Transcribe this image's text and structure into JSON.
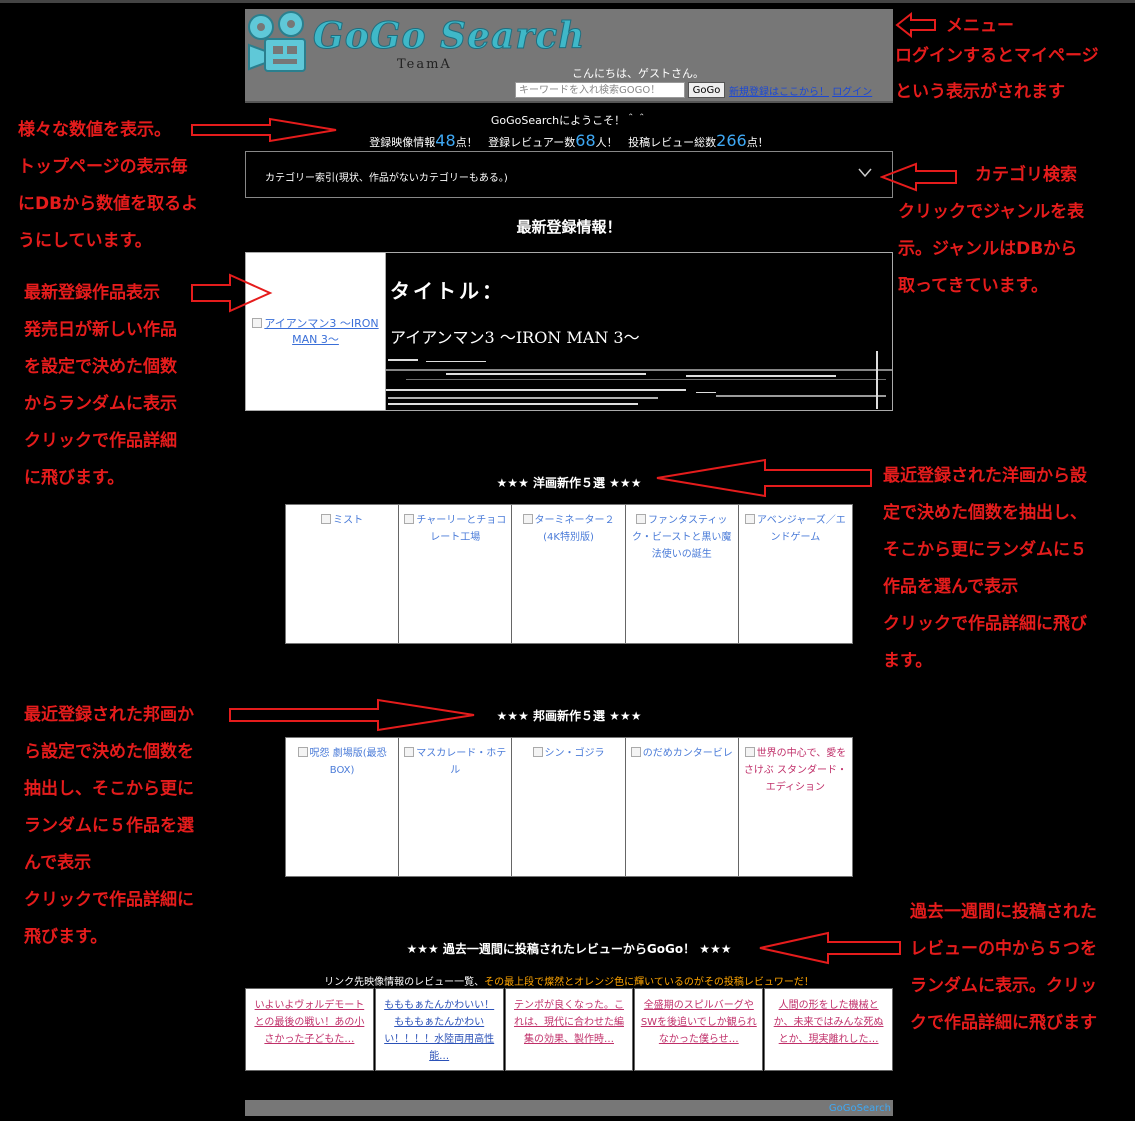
{
  "header": {
    "logo_text": "GoGo Search",
    "team": "TeamA",
    "greeting": "こんにちは、ゲストさん。",
    "search_placeholder": "キーワードを入れ検索GOGO！",
    "search_button": "GoGo",
    "register_link": "新規登録はここから！",
    "login_link": "ログイン"
  },
  "welcome": "GoGoSearchにようこそ！＾＾",
  "stats": {
    "movies_label": "登録映像情報",
    "movies_count": "48",
    "movies_unit": "点！",
    "reviewers_label": "登録レビュアー数",
    "reviewers_count": "68",
    "reviewers_unit": "人！",
    "reviews_label": "投稿レビュー総数",
    "reviews_count": "266",
    "reviews_unit": "点！"
  },
  "category": {
    "label": "カテゴリー索引(現状、作品がないカテゴリーもある。)"
  },
  "latest": {
    "heading": "最新登録情報！",
    "image_alt": "アイアンマン3 ～IRON MAN 3～",
    "title_label": "タイトル：",
    "title": "アイアンマン3 ～IRON MAN 3～"
  },
  "western": {
    "heading": "★★★ 洋画新作５選 ★★★",
    "items": [
      "ミスト",
      "チャーリーとチョコレート工場",
      "ターミネーター２(4K特別版)",
      "ファンタスティック・ビーストと黒い魔法使いの誕生",
      "アベンジャーズ／エンドゲーム"
    ]
  },
  "japanese": {
    "heading": "★★★ 邦画新作５選 ★★★",
    "items": [
      "呪怨 劇場版(最恐BOX)",
      "マスカレード・ホテル",
      "シン・ゴジラ",
      "のだめカンタービレ",
      "世界の中心で、愛をさけぶ スタンダード・エディション"
    ]
  },
  "reviews": {
    "heading": "★★★ 過去一週間に投稿されたレビューからGoGo！ ★★★",
    "sub_text": "リンク先映像情報のレビュー一覧、",
    "sub_highlight": "その最上段で燦然とオレンジ色に輝いているのがその投稿レビュワーだ！",
    "items": [
      "いよいよヴォルデモートとの最後の戦い！あの小さかった子どもた…",
      "もももぁたんかわいい！もももぁたんかわいい！！！！水陸両用高性能…",
      "テンポが良くなった。これは、現代に合わせた編集の効果、製作時…",
      "全盛期のスピルバーグやSWを後追いでしか観られなかった僕らせ…",
      "人間の形をした機械とか、未来ではみんな死ぬとか、現実離れした…"
    ]
  },
  "footer": "GoGoSearch",
  "annotations": {
    "menu": [
      "メニュー",
      "ログインするとマイページ",
      "という表示がされます"
    ],
    "stats": [
      "様々な数値を表示。",
      "トップページの表示毎",
      "にDBから数値を取るよ",
      "うにしています。"
    ],
    "category": [
      "カテゴリ検索",
      "クリックでジャンルを表",
      "示。ジャンルはDBから",
      "取ってきています。"
    ],
    "latest": [
      "最新登録作品表示",
      "発売日が新しい作品",
      "を設定で決めた個数",
      "からランダムに表示",
      "クリックで作品詳細",
      "に飛びます。"
    ],
    "western": [
      "最近登録された洋画から設",
      "定で決めた個数を抽出し、",
      "そこから更にランダムに５",
      "作品を選んで表示",
      "クリックで作品詳細に飛び",
      "ます。"
    ],
    "japanese": [
      "最近登録された邦画か",
      "ら設定で決めた個数を",
      "抽出し、そこから更に",
      "ランダムに５作品を選",
      "んで表示",
      "クリックで作品詳細に",
      "飛びます。"
    ],
    "reviews": [
      "過去一週間に投稿された",
      "レビューの中から５つを",
      "ランダムに表示。クリッ",
      "クで作品詳細に飛びます"
    ]
  },
  "colors": {
    "accent_blue": "#3fa9f5",
    "annotation_red": "#e51c1c",
    "highlight_orange": "#ffa500"
  }
}
